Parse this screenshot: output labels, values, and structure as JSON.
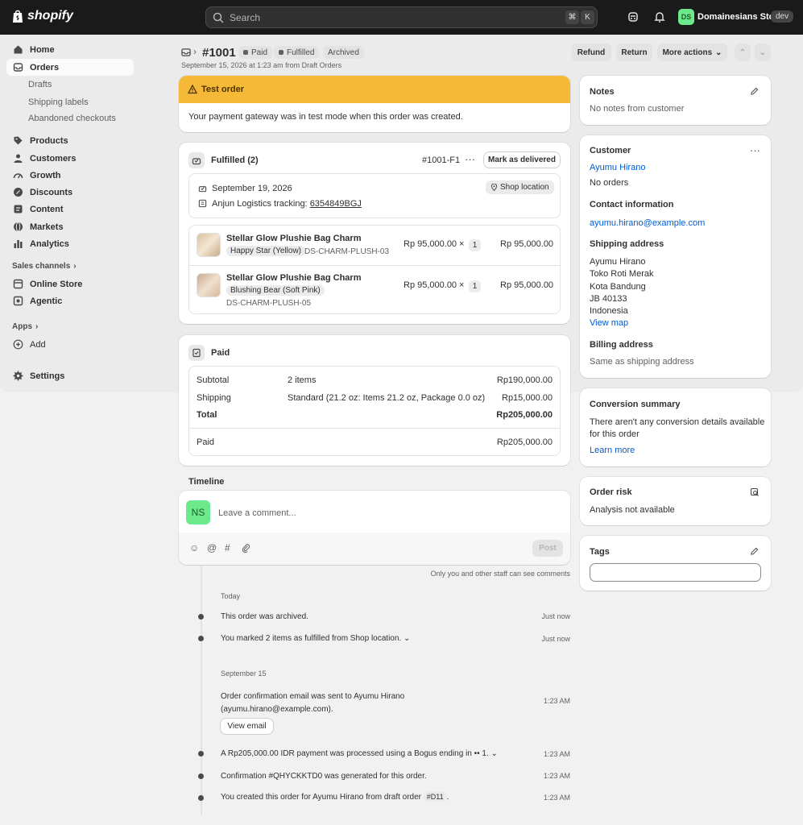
{
  "topbar": {
    "logo_text": "shopify",
    "search_placeholder": "Search",
    "kbd_1": "⌘",
    "kbd_2": "K",
    "store_initials": "DS",
    "store_name": "Domainesians Store",
    "store_badge": "dev"
  },
  "sidebar": {
    "home": "Home",
    "orders": "Orders",
    "drafts": "Drafts",
    "shipping_labels": "Shipping labels",
    "abandoned_checkouts": "Abandoned checkouts",
    "products": "Products",
    "customers": "Customers",
    "growth": "Growth",
    "discounts": "Discounts",
    "content": "Content",
    "markets": "Markets",
    "analytics": "Analytics",
    "sales_channels": "Sales channels",
    "online_store": "Online Store",
    "agentic": "Agentic",
    "apps": "Apps",
    "add": "Add",
    "settings": "Settings"
  },
  "header": {
    "order_number": "#1001",
    "badges": [
      "Paid",
      "Fulfilled",
      "Archived"
    ],
    "subtitle": "September 15, 2026 at 1:23 am from Draft Orders",
    "refund": "Refund",
    "return": "Return",
    "more_actions": "More actions"
  },
  "test_order": {
    "title": "Test order",
    "message": "Your payment gateway was in test mode when this order was created."
  },
  "fulfilled": {
    "title": "Fulfilled (2)",
    "id": "#1001-F1",
    "mark_delivered": "Mark as delivered",
    "date": "September 19, 2026",
    "location": "Shop location",
    "tracking_prefix": "Anjun Logistics tracking:",
    "tracking_number": "6354849BGJ",
    "items": [
      {
        "name": "Stellar Glow Plushie Bag Charm",
        "variant": "Happy Star (Yellow)",
        "sku": "DS-CHARM-PLUSH-03",
        "price": "Rp 95,000.00",
        "times": "×",
        "qty": "1",
        "total": "Rp 95,000.00"
      },
      {
        "name": "Stellar Glow Plushie Bag Charm",
        "variant": "Blushing Bear (Soft Pink)",
        "sku": "DS-CHARM-PLUSH-05",
        "price": "Rp 95,000.00",
        "times": "×",
        "qty": "1",
        "total": "Rp 95,000.00"
      }
    ]
  },
  "paid": {
    "title": "Paid",
    "subtotal_label": "Subtotal",
    "subtotal_desc": "2 items",
    "subtotal_value": "Rp190,000.00",
    "shipping_label": "Shipping",
    "shipping_desc": "Standard (21.2 oz: Items 21.2 oz, Package 0.0 oz)",
    "shipping_value": "Rp15,000.00",
    "total_label": "Total",
    "total_value": "Rp205,000.00",
    "paid_label": "Paid",
    "paid_value": "Rp205,000.00"
  },
  "timeline": {
    "title": "Timeline",
    "avatar": "NS",
    "comment_placeholder": "Leave a comment...",
    "post": "Post",
    "staff_note": "Only you and other staff can see comments",
    "today": "Today",
    "sep15": "September 15",
    "events": [
      {
        "text": "This order was archived.",
        "time": "Just now"
      },
      {
        "text": "You marked 2 items as fulfilled from Shop location.",
        "time": "Just now"
      },
      {
        "text": "Order confirmation email was sent to Ayumu Hirano",
        "text2": "(ayumu.hirano@example.com).",
        "time": "1:23 AM",
        "button": "View email"
      },
      {
        "text": "A Rp205,000.00 IDR payment was processed using a Bogus ending in •• 1.",
        "time": "1:23 AM"
      },
      {
        "text": "Confirmation #QHYCKKTD0 was generated for this order.",
        "time": "1:23 AM"
      },
      {
        "text": "You created this order for Ayumu Hirano from draft order",
        "tag": "#D11",
        "suffix": ".",
        "time": "1:23 AM"
      }
    ]
  },
  "notes": {
    "title": "Notes",
    "text": "No notes from customer"
  },
  "customer": {
    "title": "Customer",
    "name": "Ayumu Hirano",
    "orders": "No orders",
    "contact_title": "Contact information",
    "email": "ayumu.hirano@example.com",
    "shipping_title": "Shipping address",
    "address": [
      "Ayumu Hirano",
      "Toko Roti Merak",
      "Kota Bandung",
      "JB 40133",
      "Indonesia"
    ],
    "view_map": "View map",
    "billing_title": "Billing address",
    "billing_text": "Same as shipping address"
  },
  "conversion": {
    "title": "Conversion summary",
    "text1": "There aren't any conversion details available",
    "text2": "for this order",
    "learn_more": "Learn more"
  },
  "risk": {
    "title": "Order risk",
    "text": "Analysis not available"
  },
  "tags": {
    "title": "Tags"
  }
}
